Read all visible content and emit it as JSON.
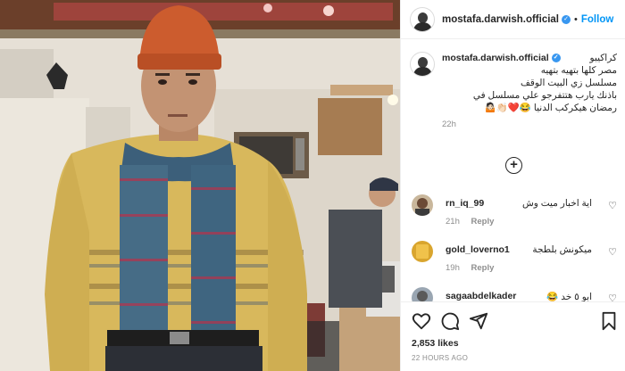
{
  "post": {
    "username": "mostafa.darwish.official",
    "verified_icon": "verified-badge-icon",
    "separator": "•",
    "follow_label": "Follow",
    "caption_first": "كراكيبو",
    "caption_lines": [
      "مصر كلها بتهيه بتهيه",
      "مسلسل زي البيت الوقف",
      "باذنك يارب هتتفرجو علي مسلسل في",
      "رمضان هيكركب الدنيا 😂❤️👏🏻🤷🏻"
    ],
    "time": "22h",
    "more_icon": "plus-circle-icon"
  },
  "comments": [
    {
      "user": "rn_iq_99",
      "text": "اية اخبار ميت وش",
      "time": "21h",
      "reply": "Reply"
    },
    {
      "user": "gold_loverno1",
      "text": "ميكونش بلطجة",
      "time": "19h",
      "reply": "Reply"
    },
    {
      "user": "sagaabdelkader",
      "text": "ابو ٥ خد 😂",
      "time": "",
      "reply": ""
    }
  ],
  "actions": {
    "icons": [
      "heart-icon",
      "comment-icon",
      "share-icon",
      "bookmark-icon"
    ],
    "likes": "2,853 likes",
    "ago": "22 HOURS AGO"
  },
  "colors": {
    "accent": "#0095f6",
    "verified": "#3897f0",
    "muted": "#8e8e8e"
  }
}
